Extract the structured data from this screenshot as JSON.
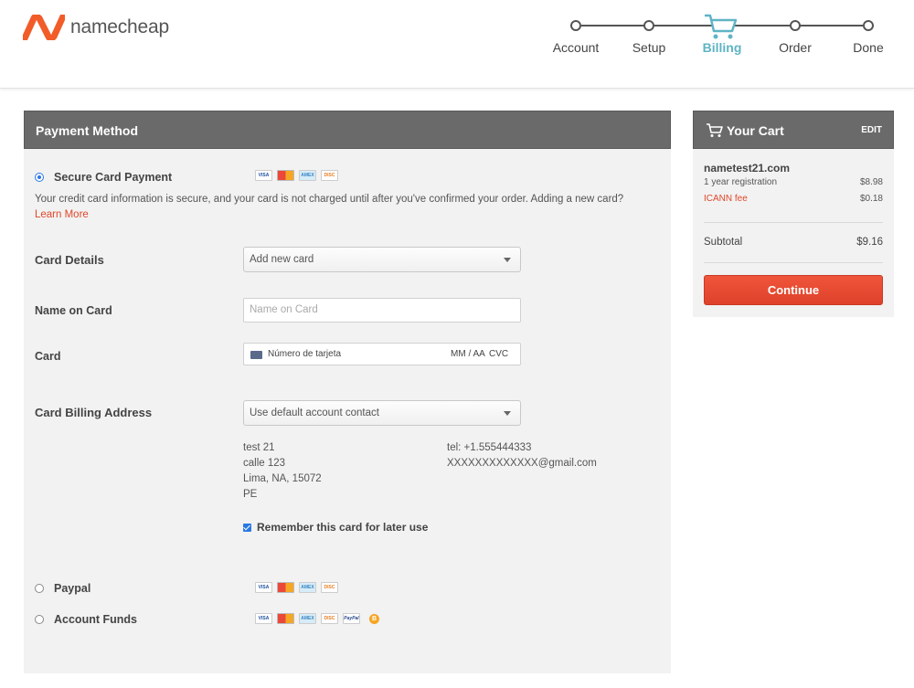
{
  "header": {
    "logo_text": "namecheap",
    "steps": [
      "Account",
      "Setup",
      "Billing",
      "Order",
      "Done"
    ],
    "active_step": "Billing"
  },
  "colors": {
    "brand_orange": "#f25c28",
    "step_active": "#5fb4c4",
    "panel_header": "#6a6a6a",
    "button_red": "#e84a31",
    "link_red": "#e0472a"
  },
  "payment": {
    "panel_title": "Payment Method",
    "methods": [
      {
        "label": "Secure Card Payment",
        "selected": true,
        "icons": [
          "visa-icon",
          "mastercard-icon",
          "amex-icon",
          "discover-icon"
        ]
      },
      {
        "label": "Paypal",
        "selected": false,
        "icons": [
          "visa-icon",
          "mastercard-icon",
          "amex-icon",
          "discover-icon"
        ]
      },
      {
        "label": "Account Funds",
        "selected": false,
        "icons": [
          "visa-icon",
          "mastercard-icon",
          "amex-icon",
          "discover-icon",
          "paypal-icon",
          "bitcoin-icon"
        ]
      }
    ],
    "info_text": "Your credit card information is secure, and your card is not charged until after you've confirmed your order. Adding a new card?",
    "learn_more": "Learn More",
    "card_details_label": "Card Details",
    "card_details_value": "Add new card",
    "name_on_card_label": "Name on Card",
    "name_on_card_placeholder": "Name on Card",
    "card_label": "Card",
    "card_number_placeholder": "Número de tarjeta",
    "card_exp_placeholder": "MM / AA",
    "card_cvc_placeholder": "CVC",
    "billing_address_label": "Card Billing Address",
    "billing_address_value": "Use default account contact",
    "address_lines": [
      "test 21",
      "calle 123",
      "Lima, NA, 15072",
      "PE"
    ],
    "contact_lines": [
      "tel: +1.555444333",
      "XXXXXXXXXXXXX@gmail.com"
    ],
    "remember_label": "Remember this card for later use",
    "remember_checked": true
  },
  "cart": {
    "title": "Your Cart",
    "edit_label": "EDIT",
    "domain": "nametest21.com",
    "lines": [
      {
        "label": "1 year registration",
        "amount": "$8.98"
      },
      {
        "label": "ICANN fee",
        "amount": "$0.18"
      }
    ],
    "subtotal_label": "Subtotal",
    "subtotal_amount": "$9.16",
    "continue_label": "Continue"
  }
}
